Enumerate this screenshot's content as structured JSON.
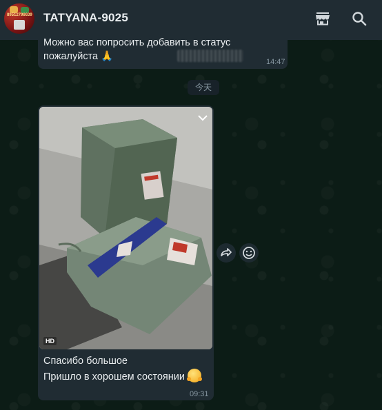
{
  "header": {
    "contact_name": "TATYANA-9025",
    "avatar_text": "89512798639"
  },
  "icons": {
    "store": "store-icon",
    "search": "search-icon",
    "forward": "forward-icon",
    "reaction": "emoji-reaction-icon",
    "menu": "chevron-down-icon"
  },
  "messages": [
    {
      "text": "Можно вас попросить добавить в статус\nпожалуйста 🙏",
      "time": "14:47"
    },
    {
      "date_divider": "今天"
    },
    {
      "media_badge": "HD",
      "caption_line1": "Спасибо большое",
      "caption_line2": "Пришло в хорошем состоянии",
      "time": "09:31"
    }
  ],
  "colors": {
    "header_bg": "#202c33",
    "bubble_bg": "#202c33",
    "wallpaper": "#0c1c16",
    "meta_text": "#8696a0"
  }
}
